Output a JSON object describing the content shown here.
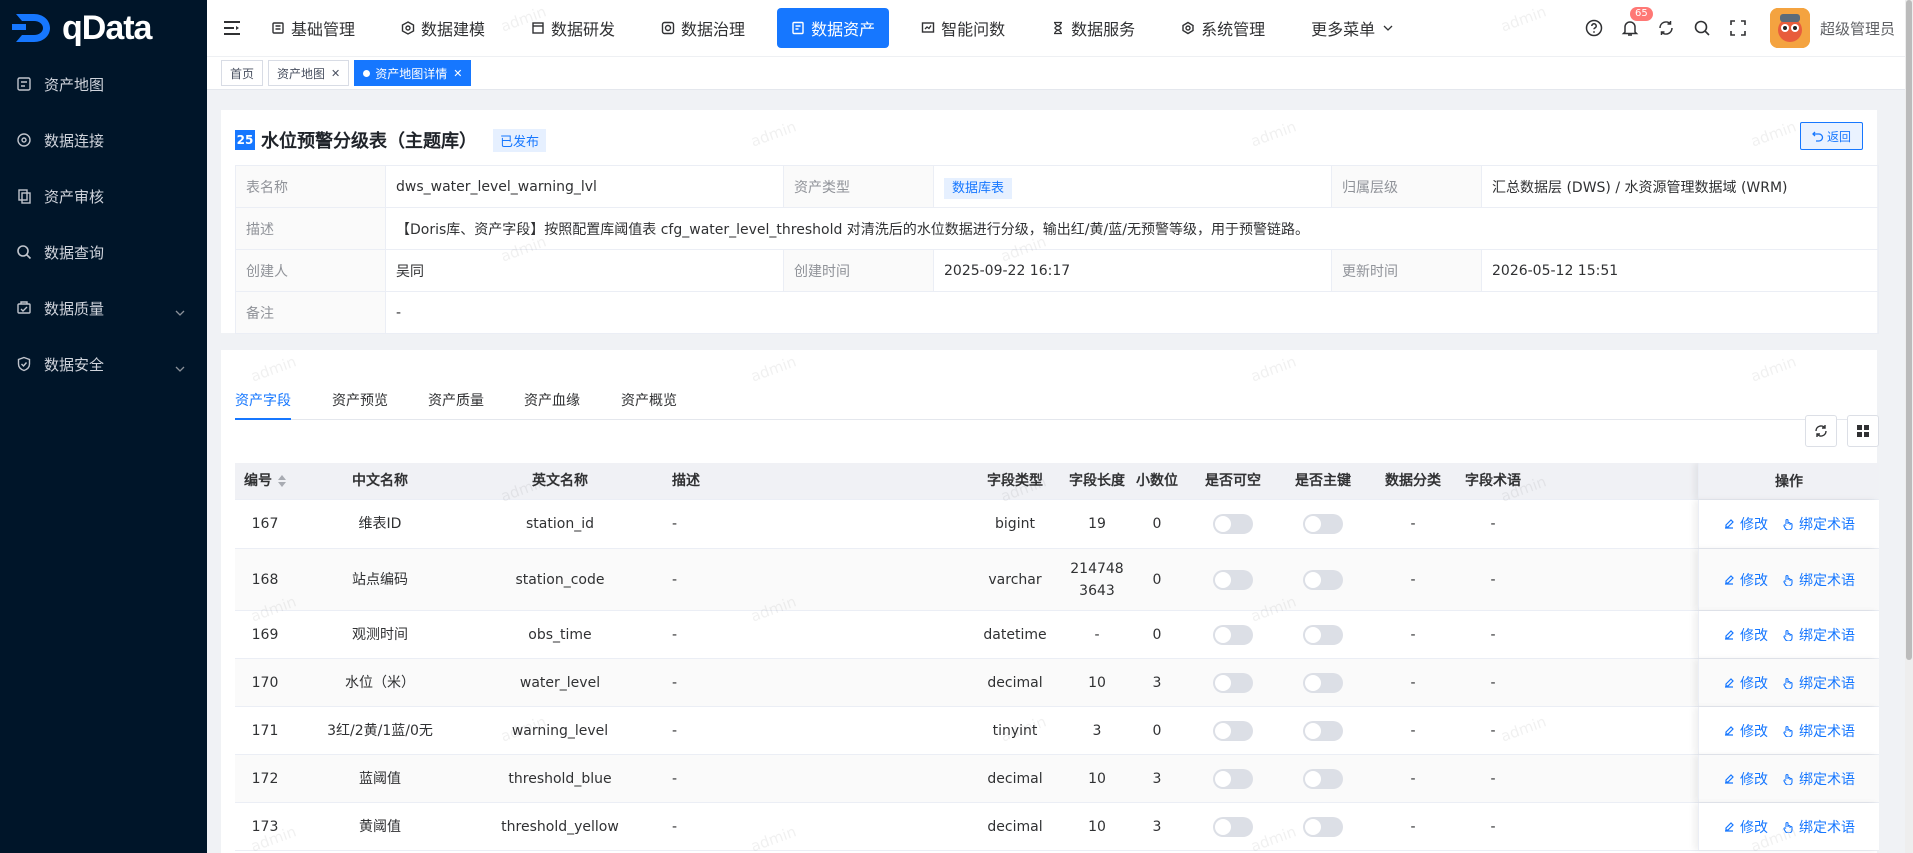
{
  "app": {
    "logo_text": "qData",
    "user_name": "超级管理员",
    "notification_count": "65"
  },
  "sidebar": {
    "items": [
      {
        "label": "资产地图",
        "icon": "asset-map-icon"
      },
      {
        "label": "数据连接",
        "icon": "connection-icon"
      },
      {
        "label": "资产审核",
        "icon": "audit-icon"
      },
      {
        "label": "数据查询",
        "icon": "search-icon"
      },
      {
        "label": "数据质量",
        "icon": "quality-icon",
        "expandable": true
      },
      {
        "label": "数据安全",
        "icon": "security-icon",
        "expandable": true
      }
    ]
  },
  "topnav": {
    "items": [
      {
        "label": "基础管理"
      },
      {
        "label": "数据建模"
      },
      {
        "label": "数据研发"
      },
      {
        "label": "数据治理"
      },
      {
        "label": "数据资产",
        "active": true
      },
      {
        "label": "智能问数"
      },
      {
        "label": "数据服务"
      },
      {
        "label": "系统管理"
      },
      {
        "label": "更多菜单"
      }
    ]
  },
  "tabs_view": [
    {
      "label": "首页"
    },
    {
      "label": "资产地图"
    },
    {
      "label": "资产地图详情",
      "active": true
    }
  ],
  "asset": {
    "num": "25",
    "title": "水位预警分级表（主题库）",
    "status": "已发布",
    "back_label": "返回",
    "table_name_label": "表名称",
    "table_name": "dws_water_level_warning_lvl",
    "type_label": "资产类型",
    "type": "数据库表",
    "layer_label": "归属层级",
    "layer": "汇总数据层 (DWS) / 水资源管理数据域 (WRM)",
    "desc_label": "描述",
    "desc": "【Doris库、资产字段】按照配置库阈值表 cfg_water_level_threshold 对清洗后的水位数据进行分级，输出红/黄/蓝/无预警等级，用于预警链路。",
    "creator_label": "创建人",
    "creator": "吴同",
    "created_label": "创建时间",
    "created": "2025-09-22 16:17",
    "updated_label": "更新时间",
    "updated": "2026-05-12 15:51",
    "remark_label": "备注",
    "remark": "-"
  },
  "detail_tabs": [
    "资产字段",
    "资产预览",
    "资产质量",
    "资产血缘",
    "资产概览"
  ],
  "grid": {
    "headers": [
      "编号",
      "中文名称",
      "英文名称",
      "描述",
      "字段类型",
      "字段长度",
      "小数位",
      "是否可空",
      "是否主键",
      "数据分类",
      "字段术语",
      "操作"
    ],
    "op_edit": "修改",
    "op_bind": "绑定术语",
    "rows": [
      {
        "id": "167",
        "cn": "维表ID",
        "en": "station_id",
        "desc": "-",
        "type": "bigint",
        "len": "19",
        "dec": "0",
        "cls": "-",
        "term": "-"
      },
      {
        "id": "168",
        "cn": "站点编码",
        "en": "station_code",
        "desc": "-",
        "type": "varchar",
        "len": "2147483643",
        "dec": "0",
        "cls": "-",
        "term": "-"
      },
      {
        "id": "169",
        "cn": "观测时间",
        "en": "obs_time",
        "desc": "-",
        "type": "datetime",
        "len": "-",
        "dec": "0",
        "cls": "-",
        "term": "-"
      },
      {
        "id": "170",
        "cn": "水位（米）",
        "en": "water_level",
        "desc": "-",
        "type": "decimal",
        "len": "10",
        "dec": "3",
        "cls": "-",
        "term": "-"
      },
      {
        "id": "171",
        "cn": "3红/2黄/1蓝/0无",
        "en": "warning_level",
        "desc": "-",
        "type": "tinyint",
        "len": "3",
        "dec": "0",
        "cls": "-",
        "term": "-"
      },
      {
        "id": "172",
        "cn": "蓝阈值",
        "en": "threshold_blue",
        "desc": "-",
        "type": "decimal",
        "len": "10",
        "dec": "3",
        "cls": "-",
        "term": "-"
      },
      {
        "id": "173",
        "cn": "黄阈值",
        "en": "threshold_yellow",
        "desc": "-",
        "type": "decimal",
        "len": "10",
        "dec": "3",
        "cls": "-",
        "term": "-"
      }
    ]
  },
  "watermark": "admin"
}
